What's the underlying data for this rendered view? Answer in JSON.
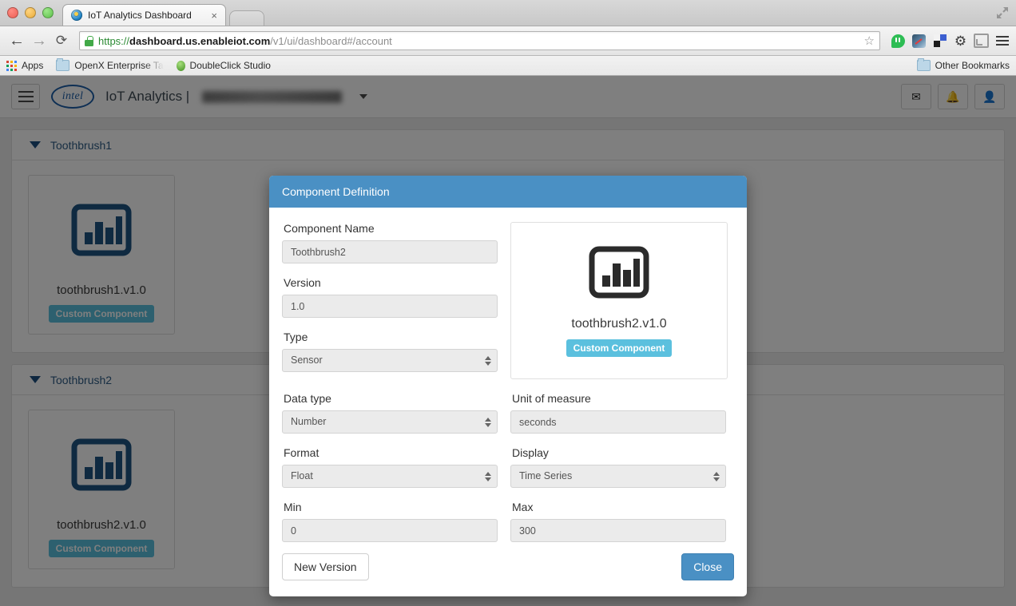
{
  "browser": {
    "tab": {
      "title": "IoT Analytics Dashboard",
      "close_label": "×"
    },
    "nav": {
      "back": "←",
      "forward": "→",
      "reload": "⟳"
    },
    "url": {
      "scheme": "https://",
      "host": "dashboard.us.enableiot.com",
      "path": "/v1/ui/dashboard#/account"
    },
    "star": "☆",
    "icons": [
      "lock-icon",
      "hangouts-icon",
      "speedtest-icon",
      "squares-icon",
      "gear-icon",
      "cast-icon",
      "menu-icon",
      "fullscreen-icon"
    ],
    "bookmarks": {
      "apps": "Apps",
      "items": [
        {
          "label": "OpenX Enterprise Ta",
          "icon": "folder-icon"
        },
        {
          "label": "DoubleClick Studio",
          "icon": "green-dot-icon"
        }
      ],
      "other": "Other Bookmarks"
    }
  },
  "app": {
    "brand": "intel",
    "title": "IoT Analytics |",
    "header_icons": [
      {
        "name": "mail-icon",
        "glyph": "✉"
      },
      {
        "name": "bell-icon",
        "glyph": "🔔"
      },
      {
        "name": "user-icon",
        "glyph": "👤"
      }
    ],
    "sections": [
      {
        "title": "Toothbrush1",
        "cards": [
          {
            "name": "toothbrush1.v1.0",
            "badge": "Custom Component",
            "icon": "bar-chart-icon"
          }
        ]
      },
      {
        "title": "Toothbrush2",
        "cards": [
          {
            "name": "toothbrush2.v1.0",
            "badge": "Custom Component",
            "icon": "bar-chart-icon"
          }
        ]
      }
    ]
  },
  "modal": {
    "title": "Component Definition",
    "fields": {
      "component_name": {
        "label": "Component Name",
        "value": "Toothbrush2"
      },
      "version": {
        "label": "Version",
        "value": "1.0"
      },
      "type": {
        "label": "Type",
        "value": "Sensor"
      },
      "data_type": {
        "label": "Data type",
        "value": "Number"
      },
      "unit_of_measure": {
        "label": "Unit of measure",
        "value": "seconds"
      },
      "format": {
        "label": "Format",
        "value": "Float"
      },
      "display": {
        "label": "Display",
        "value": "Time Series"
      },
      "min": {
        "label": "Min",
        "value": "0"
      },
      "max": {
        "label": "Max",
        "value": "300"
      }
    },
    "preview": {
      "name": "toothbrush2.v1.0",
      "badge": "Custom Component",
      "icon": "bar-chart-icon"
    },
    "buttons": {
      "new_version": "New Version",
      "close": "Close"
    }
  },
  "colors": {
    "modal_header": "#4a90c4",
    "primary_button": "#4a90c4",
    "badge": "#5bc0de",
    "card_icon": "#1f5582",
    "section_title": "#2f5d86"
  }
}
